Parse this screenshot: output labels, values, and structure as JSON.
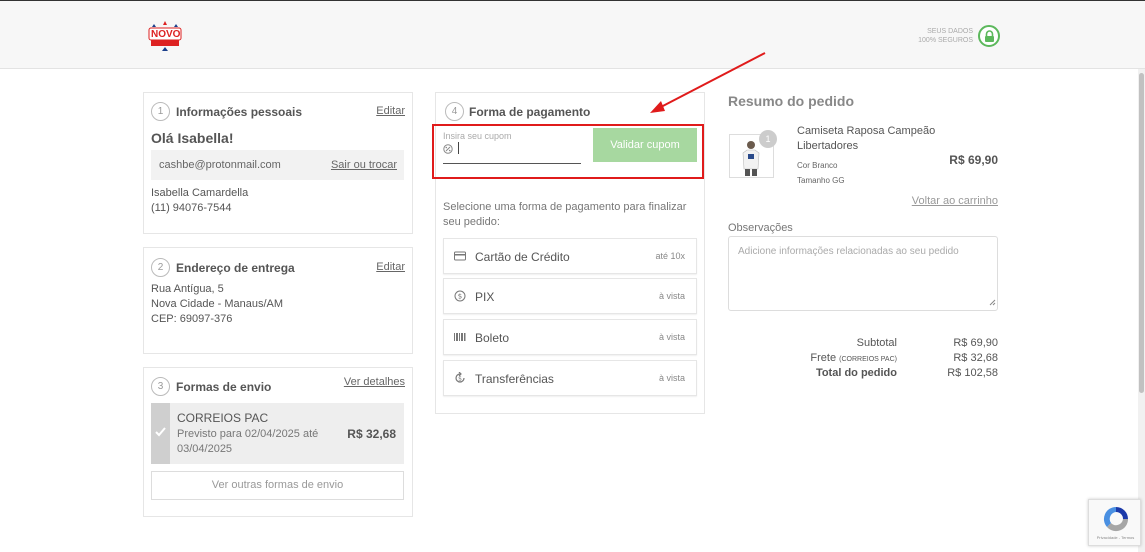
{
  "header": {
    "logo_text": "NOVO",
    "secure_line1": "SEUS DADOS",
    "secure_line2": "100% SEGUROS"
  },
  "personal": {
    "step": "1",
    "title": "Informações pessoais",
    "edit_label": "Editar",
    "greeting": "Olá Isabella!",
    "email": "cashbe@protonmail.com",
    "switch_label": "Sair ou trocar",
    "name": "Isabella Camardella",
    "phone": "(11) 94076-7544"
  },
  "address": {
    "step": "2",
    "title": "Endereço de entrega",
    "edit_label": "Editar",
    "line1": "Rua Antígua, 5",
    "line2": "Nova Cidade - Manaus/AM",
    "line3": "CEP: 69097-376"
  },
  "shipping": {
    "step": "3",
    "title": "Formas de envio",
    "details_label": "Ver detalhes",
    "option_name": "CORREIOS PAC",
    "option_desc": "Previsto para 02/04/2025 até 03/04/2025",
    "option_price": "R$ 32,68",
    "more_label": "Ver outras formas de envio"
  },
  "payment": {
    "step": "4",
    "title": "Forma de pagamento",
    "coupon_placeholder": "Insira seu cupom",
    "coupon_button": "Validar cupom",
    "intro": "Selecione uma forma de pagamento para finalizar seu pedido:",
    "options": [
      {
        "label": "Cartão de Crédito",
        "note": "até 10x",
        "icon": "credit-card-icon"
      },
      {
        "label": "PIX",
        "note": "à vista",
        "icon": "pix-icon"
      },
      {
        "label": "Boleto",
        "note": "à vista",
        "icon": "barcode-icon"
      },
      {
        "label": "Transferências",
        "note": "à vista",
        "icon": "transfer-icon"
      }
    ]
  },
  "summary": {
    "title": "Resumo do pedido",
    "product_qty": "1",
    "product_name": "Camiseta Raposa Campeão Libertadores",
    "product_color": "Cor Branco",
    "product_size": "Tamanho GG",
    "product_price": "R$ 69,90",
    "back_cart": "Voltar ao carrinho",
    "notes_label": "Observações",
    "notes_placeholder": "Adicione informações relacionadas ao seu pedido",
    "subtotal_label": "Subtotal",
    "subtotal_value": "R$ 69,90",
    "shipping_label": "Frete",
    "shipping_sublabel": "(CORREIOS PAC)",
    "shipping_value": "R$ 32,68",
    "total_label": "Total do pedido",
    "total_value": "R$ 102,58"
  },
  "recaptcha": {
    "text": "Privacidade - Termos"
  },
  "colors": {
    "accent_green": "#a7d8a0",
    "highlight_red": "#e01b1b",
    "lock_green": "#5cb85c"
  }
}
